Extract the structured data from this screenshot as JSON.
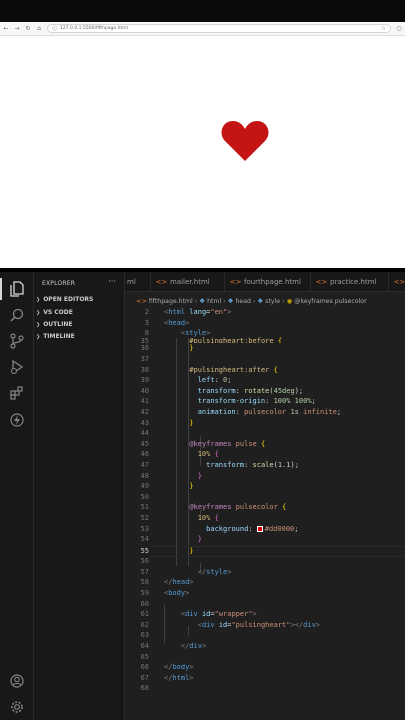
{
  "browser": {
    "url": "127.0.0.1:5500/fifthpage.html"
  },
  "colors": {
    "heart": "#c41414",
    "editor_bg": "#1f1f1f",
    "accent_orange": "#e37933"
  },
  "vscode": {
    "explorer": {
      "title": "EXPLORER",
      "more": "···",
      "sections": [
        "OPEN EDITORS",
        "VS CODE",
        "OUTLINE",
        "TIMELINE"
      ]
    },
    "tabs": [
      {
        "label": "ml"
      },
      {
        "label": "mailer.html"
      },
      {
        "label": "fourthpage.html"
      },
      {
        "label": "practice.html"
      },
      {
        "label": "mc"
      }
    ],
    "breadcrumb": [
      "fifthpage.html",
      "html",
      "head",
      "style",
      "@keyframes pulsecolor"
    ],
    "activity_icons": [
      "files-icon",
      "search-icon",
      "source-control-icon",
      "run-debug-icon",
      "extensions-icon",
      "lightning-icon",
      "account-icon",
      "settings-gear-icon"
    ],
    "current_line": 55
  }
}
